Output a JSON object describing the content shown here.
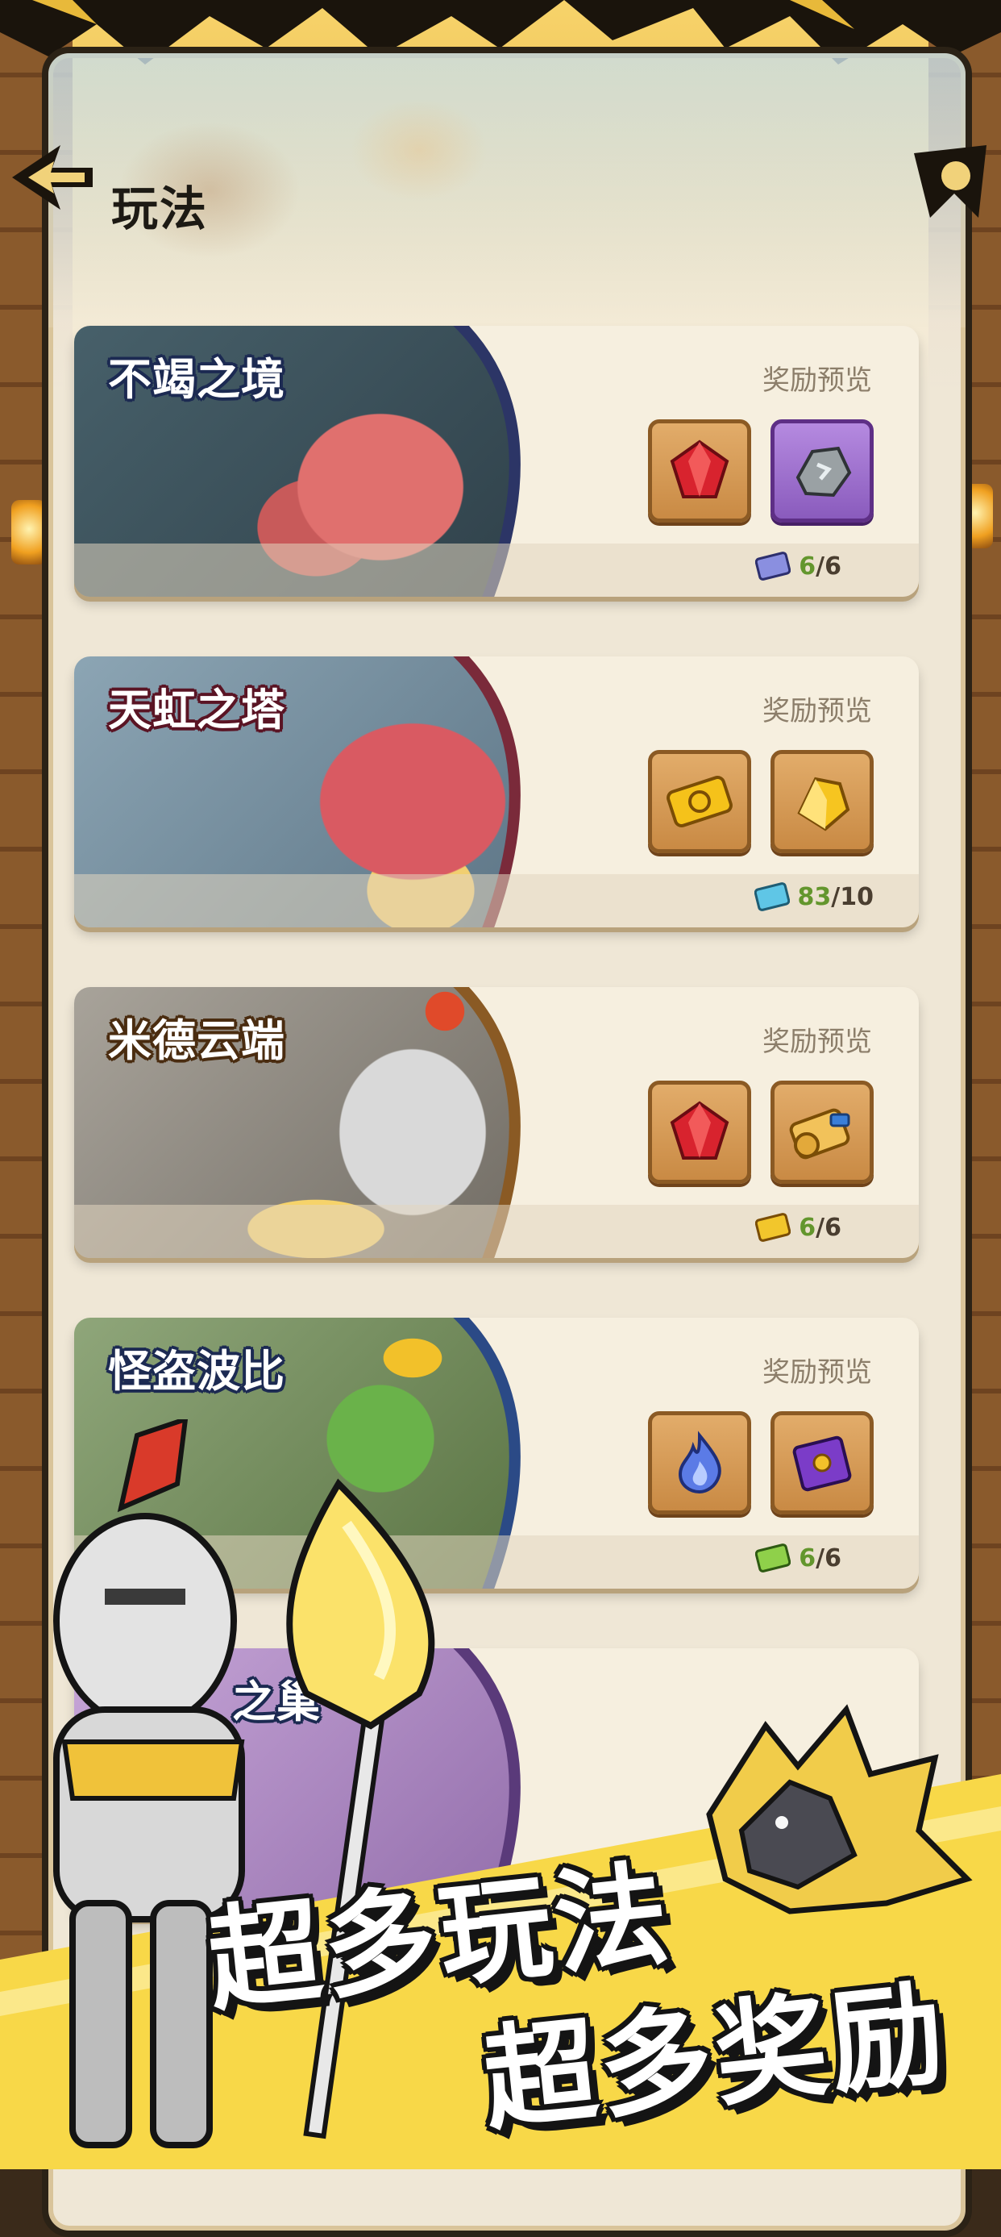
{
  "screen": {
    "title": "玩法"
  },
  "reward_preview_label": "奖励预览",
  "modes": [
    {
      "name": "不竭之境",
      "theme": "#2c3566",
      "rewards": [
        {
          "icon": "red-gem-icon",
          "frame": "bronze"
        },
        {
          "icon": "grey-ore-icon",
          "frame": "purple"
        }
      ],
      "ticket_icon": "blue-ticket-icon",
      "ticket_current": "6",
      "ticket_max": "/6"
    },
    {
      "name": "天虹之塔",
      "theme": "#7a2a3a",
      "rewards": [
        {
          "icon": "gold-coupon-icon",
          "frame": "bronze"
        },
        {
          "icon": "gold-ore-icon",
          "frame": "bronze"
        }
      ],
      "ticket_icon": "cyan-ticket-icon",
      "ticket_current": "83",
      "ticket_max": "/10"
    },
    {
      "name": "米德云端",
      "theme": "#6a4520",
      "rewards": [
        {
          "icon": "red-gem-icon",
          "frame": "bronze"
        },
        {
          "icon": "scroll-icon",
          "frame": "bronze"
        }
      ],
      "ticket_icon": "gold-ticket-icon",
      "ticket_current": "6",
      "ticket_max": "/6"
    },
    {
      "name": "怪盗波比",
      "theme": "#2b4a86",
      "rewards": [
        {
          "icon": "blue-flame-icon",
          "frame": "bronze"
        },
        {
          "icon": "spellbook-icon",
          "frame": "bronze"
        }
      ],
      "ticket_icon": "green-ticket-icon",
      "ticket_current": "6",
      "ticket_max": "/6"
    },
    {
      "name": "之巢",
      "theme": "#5a3a7a",
      "rewards": [],
      "ticket_icon": "",
      "ticket_current": "",
      "ticket_max": ""
    }
  ],
  "promo": {
    "slogan_line1": "超多玩法",
    "slogan_line2": "超多奖励"
  }
}
